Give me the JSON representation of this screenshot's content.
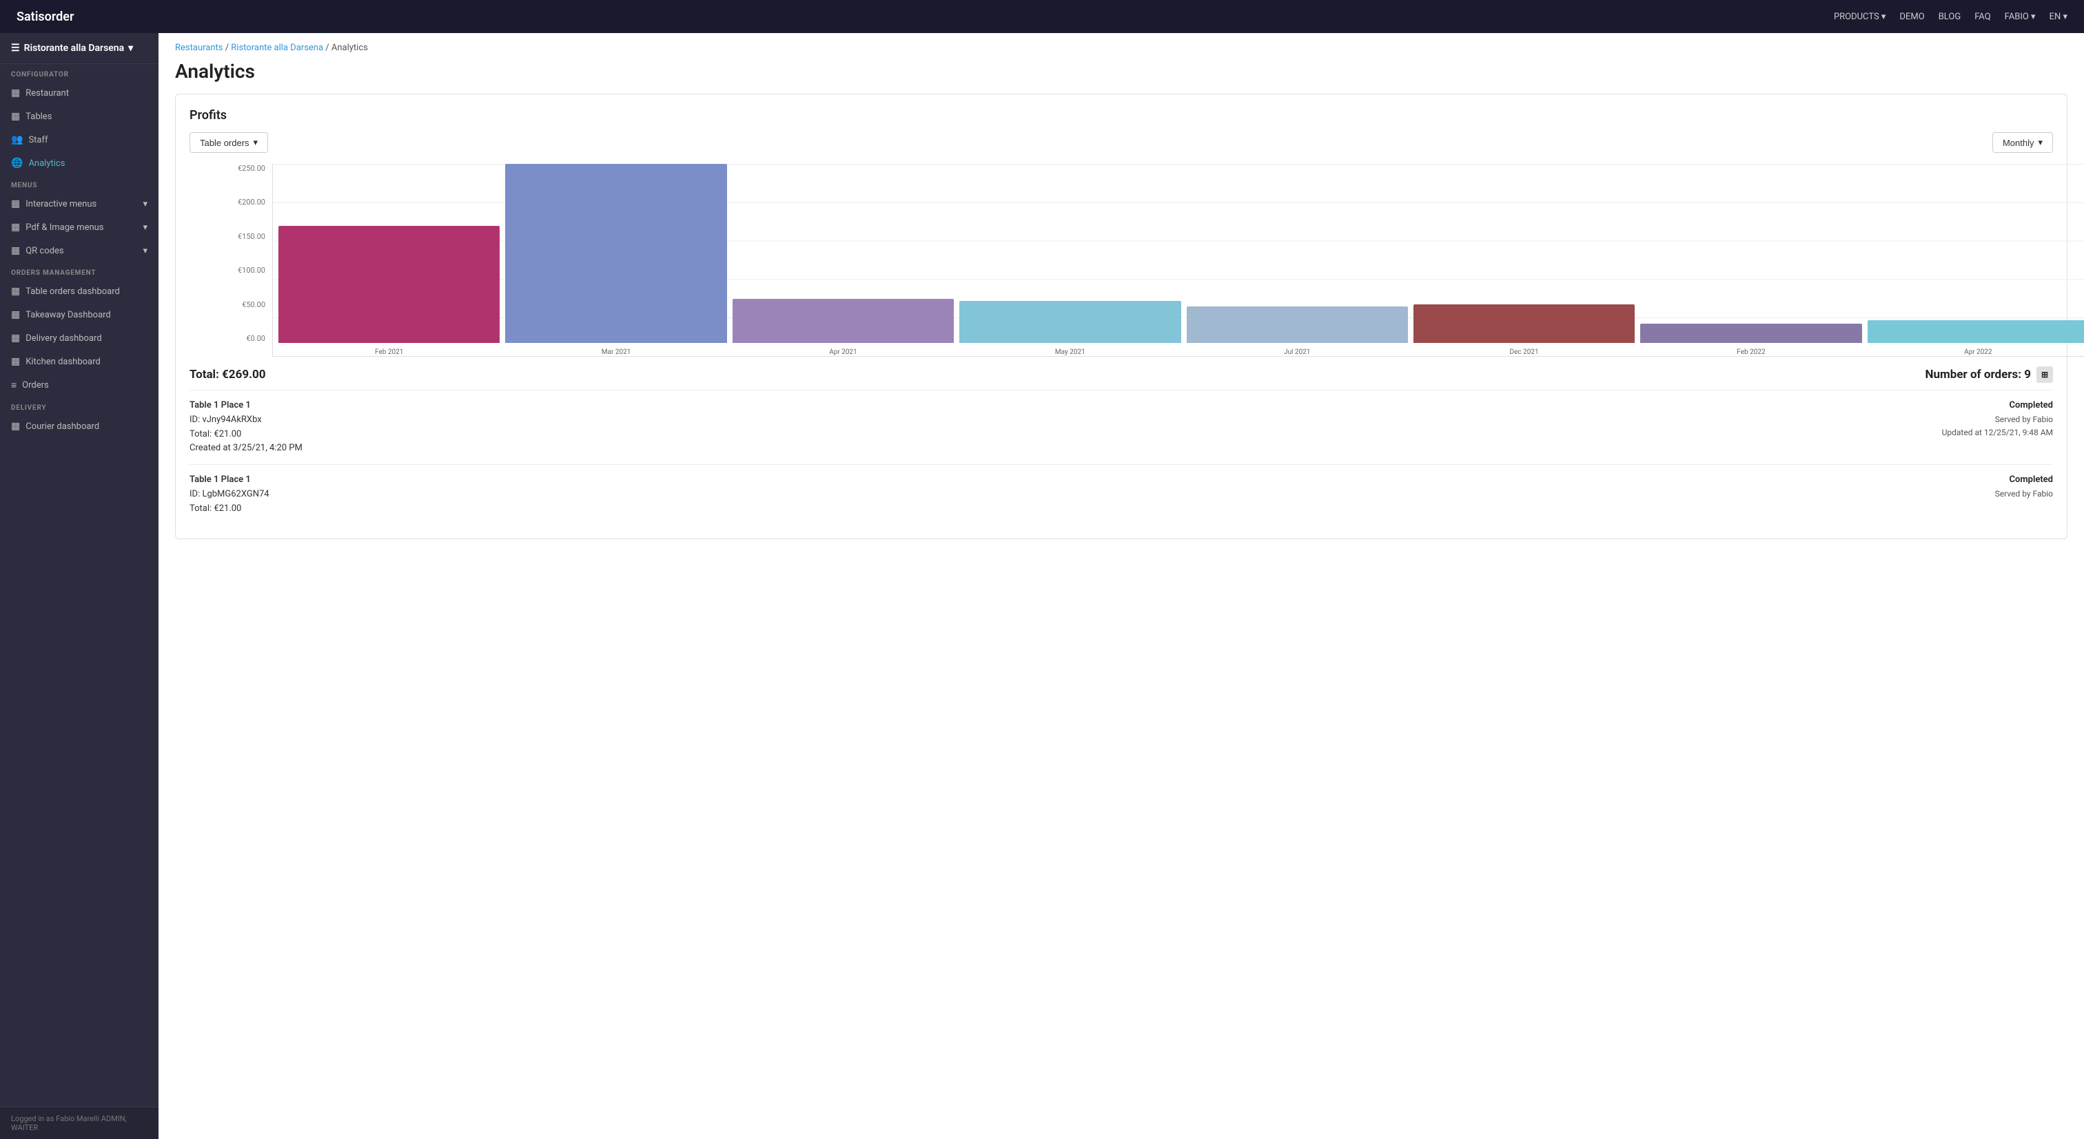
{
  "topnav": {
    "brand": "Satisorder",
    "links": [
      "PRODUCTS",
      "DEMO",
      "BLOG",
      "FAQ",
      "FABIO",
      "EN"
    ]
  },
  "sidebar": {
    "restaurant_selector": "Ristorante alla Darsena",
    "sections": [
      {
        "label": "CONFIGURATOR",
        "items": [
          {
            "id": "restaurant",
            "icon": "▦",
            "label": "Restaurant"
          },
          {
            "id": "tables",
            "icon": "▦",
            "label": "Tables"
          },
          {
            "id": "staff",
            "icon": "👥",
            "label": "Staff"
          },
          {
            "id": "analytics",
            "icon": "🌐",
            "label": "Analytics",
            "active": true
          }
        ]
      },
      {
        "label": "MENUS",
        "items": [
          {
            "id": "interactive-menus",
            "icon": "▦",
            "label": "Interactive menus",
            "has_arrow": true
          },
          {
            "id": "pdf-image-menus",
            "icon": "▦",
            "label": "Pdf & Image menus",
            "has_arrow": true
          },
          {
            "id": "qr-codes",
            "icon": "▦",
            "label": "QR codes",
            "has_arrow": true
          }
        ]
      },
      {
        "label": "ORDERS MANAGEMENT",
        "items": [
          {
            "id": "table-orders-dashboard",
            "icon": "▦",
            "label": "Table orders dashboard"
          },
          {
            "id": "takeaway-dashboard",
            "icon": "▦",
            "label": "Takeaway Dashboard"
          },
          {
            "id": "delivery-dashboard",
            "icon": "▦",
            "label": "Delivery dashboard"
          },
          {
            "id": "kitchen-dashboard",
            "icon": "▦",
            "label": "Kitchen dashboard"
          },
          {
            "id": "orders",
            "icon": "≡",
            "label": "Orders"
          }
        ]
      },
      {
        "label": "DELIVERY",
        "items": [
          {
            "id": "courier-dashboard",
            "icon": "▦",
            "label": "Courier dashboard"
          }
        ]
      }
    ],
    "footer": "Logged in as Fabio Marelli  ADMIN, WAITER"
  },
  "breadcrumb": {
    "items": [
      "Restaurants",
      "Ristorante alla Darsena",
      "Analytics"
    ],
    "links": [
      true,
      true,
      false
    ]
  },
  "page": {
    "title": "Analytics"
  },
  "profits": {
    "section_title": "Profits",
    "filter_label": "Table orders",
    "period_label": "Monthly",
    "chart": {
      "bars": [
        {
          "label": "Feb 2021",
          "value": 170,
          "color": "#b0336e",
          "height_pct": 61
        },
        {
          "label": "Mar 2021",
          "value": 270,
          "color": "#7b8ec8",
          "height_pct": 97
        },
        {
          "label": "Apr 2021",
          "value": 65,
          "color": "#9b84b8",
          "height_pct": 23
        },
        {
          "label": "May 2021",
          "value": 60,
          "color": "#82c4d8",
          "height_pct": 22
        },
        {
          "label": "Jul 2021",
          "value": 52,
          "color": "#a0b8d0",
          "height_pct": 19
        },
        {
          "label": "Dec 2021",
          "value": 55,
          "color": "#9a4a4a",
          "height_pct": 20
        },
        {
          "label": "Feb 2022",
          "value": 28,
          "color": "#8878a8",
          "height_pct": 10
        },
        {
          "label": "Apr 2022",
          "value": 32,
          "color": "#78c8d8",
          "height_pct": 12
        }
      ],
      "y_labels": [
        "€250.00",
        "€200.00",
        "€150.00",
        "€100.00",
        "€50.00",
        "€0.00"
      ]
    },
    "total": "Total: €269.00",
    "number_of_orders": "Number of orders: 9",
    "orders": [
      {
        "title": "Table 1 Place 1",
        "id": "ID: vJny94AkRXbx",
        "total": "Total: €21.00",
        "created": "Created at 3/25/21, 4:20 PM",
        "status": "Completed",
        "served_by": "Served by Fabio",
        "updated": "Updated at 12/25/21, 9:48 AM"
      },
      {
        "title": "Table 1 Place 1",
        "id": "ID: LgbMG62XGN74",
        "total": "Total: €21.00",
        "created": "",
        "status": "Completed",
        "served_by": "Served by Fabio",
        "updated": ""
      }
    ]
  }
}
